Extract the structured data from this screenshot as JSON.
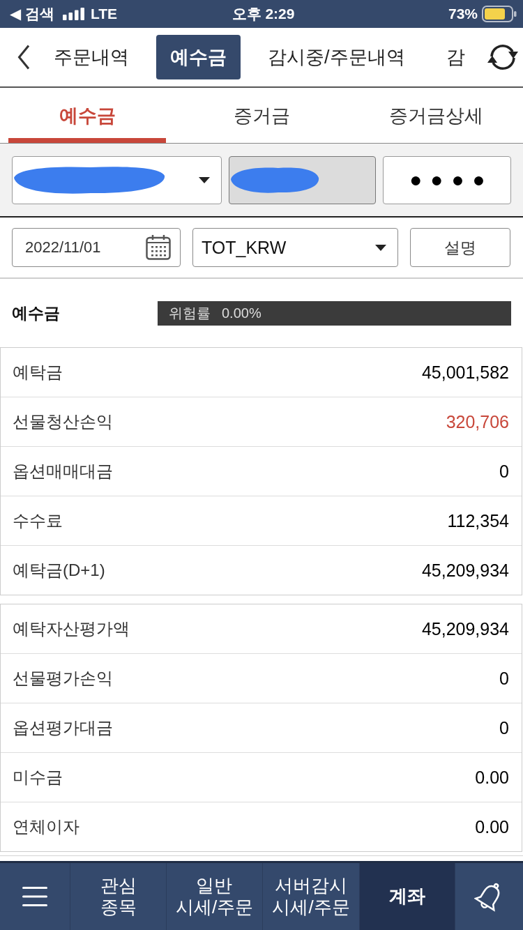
{
  "status_bar": {
    "back_label": "◀ 검색",
    "network": "LTE",
    "time": "오후 2:29",
    "battery": "73%"
  },
  "nav_tabs": [
    {
      "label": "주문내역",
      "selected": false
    },
    {
      "label": "예수금",
      "selected": true
    },
    {
      "label": "감시중/주문내역",
      "selected": false
    },
    {
      "label": "감",
      "selected": false
    }
  ],
  "sub_tabs": [
    {
      "label": "예수금",
      "selected": true
    },
    {
      "label": "증거금",
      "selected": false
    },
    {
      "label": "증거금상세",
      "selected": false
    }
  ],
  "account_fields": [
    {
      "kind": "select",
      "redacted": true,
      "disabled": false
    },
    {
      "kind": "text",
      "redacted": true,
      "disabled": true
    },
    {
      "kind": "password",
      "value": "●●●●",
      "disabled": false
    }
  ],
  "filters": [
    {
      "kind": "date",
      "value": "2022/11/01"
    },
    {
      "kind": "select",
      "value": "TOT_KRW"
    },
    {
      "kind": "button",
      "label": "설명"
    }
  ],
  "summary": {
    "title": "예수금",
    "risk_label": "위험률",
    "risk_value": "0.00%"
  },
  "tables": [
    {
      "rows": [
        {
          "label": "예탁금",
          "value": "45,001,582",
          "color": "#000000"
        },
        {
          "label": "선물청산손익",
          "value": "320,706",
          "color": "#c8473a"
        },
        {
          "label": "옵션매매대금",
          "value": "0",
          "color": "#000000"
        },
        {
          "label": "수수료",
          "value": "112,354",
          "color": "#000000"
        },
        {
          "label": "예탁금(D+1)",
          "value": "45,209,934",
          "color": "#000000"
        }
      ]
    },
    {
      "rows": [
        {
          "label": "예탁자산평가액",
          "value": "45,209,934",
          "color": "#000000"
        },
        {
          "label": "선물평가손익",
          "value": "0",
          "color": "#000000"
        },
        {
          "label": "옵션평가대금",
          "value": "0",
          "color": "#000000"
        },
        {
          "label": "미수금",
          "value": "0.00",
          "color": "#000000"
        },
        {
          "label": "연체이자",
          "value": "0.00",
          "color": "#000000"
        }
      ]
    }
  ],
  "bottom_nav": [
    {
      "kind": "menu",
      "selected": false
    },
    {
      "kind": "text",
      "label": "관심\n종목",
      "selected": false
    },
    {
      "kind": "text",
      "label": "일반\n시세/주문",
      "selected": false
    },
    {
      "kind": "text",
      "label": "서버감시\n시세/주문",
      "selected": false
    },
    {
      "kind": "text",
      "label": "계좌",
      "selected": true
    },
    {
      "kind": "bell",
      "selected": false
    }
  ]
}
